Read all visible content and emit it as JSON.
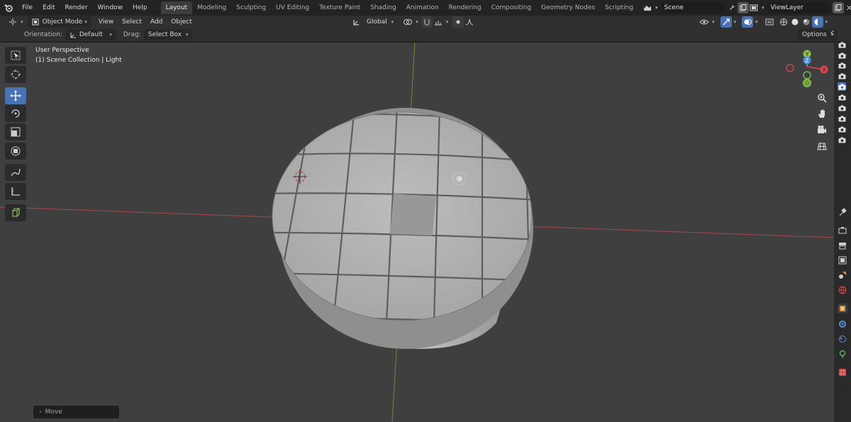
{
  "menu": [
    "File",
    "Edit",
    "Render",
    "Window",
    "Help"
  ],
  "workspaces": [
    "Layout",
    "Modeling",
    "Sculpting",
    "UV Editing",
    "Texture Paint",
    "Shading",
    "Animation",
    "Rendering",
    "Compositing",
    "Geometry Nodes",
    "Scripting"
  ],
  "active_workspace": "Layout",
  "scene_name": "Scene",
  "view_layer": "ViewLayer",
  "header": {
    "mode": "Object Mode",
    "view": "View",
    "select": "Select",
    "add": "Add",
    "object": "Object",
    "transform_orientation": "Global"
  },
  "tool_settings": {
    "orientation_label": "Orientation:",
    "orientation_value": "Default",
    "drag_label": "Drag:",
    "drag_value": "Select Box",
    "options": "Options"
  },
  "viewport": {
    "view_name": "User Perspective",
    "collection_info": "(1) Scene Collection | Light"
  },
  "gizmo": {
    "x": "X",
    "y": "Y",
    "z": "Z"
  },
  "last_operator": "Move",
  "colors": {
    "accent": "#4772b3",
    "x_axis": "#e0454f",
    "y_axis": "#8bc34a",
    "z_axis": "#4a90e2",
    "viewport_bg": "#3f3f3f"
  }
}
